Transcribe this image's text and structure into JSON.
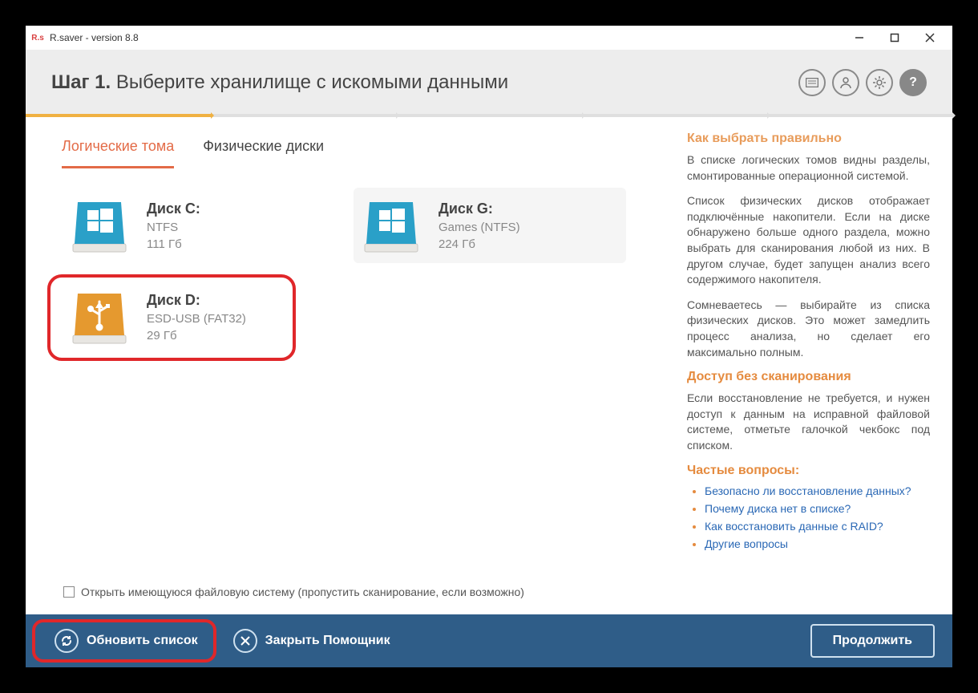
{
  "window": {
    "title": "R.saver - version 8.8"
  },
  "header": {
    "step_prefix": "Шаг 1.",
    "step_title": "Выберите хранилище с искомыми данными"
  },
  "tabs": {
    "logical": "Логические тома",
    "physical": "Физические диски"
  },
  "disks": {
    "c": {
      "name": "Диск C:",
      "fs": "NTFS",
      "size": "111 Гб"
    },
    "g": {
      "name": "Диск G:",
      "fs": "Games (NTFS)",
      "size": "224 Гб"
    },
    "d": {
      "name": "Диск D:",
      "fs": "ESD-USB (FAT32)",
      "size": "29 Гб"
    }
  },
  "checkbox": {
    "label": "Открыть имеющуюся файловую систему (пропустить сканирование, если возможно)"
  },
  "sidebar": {
    "h1_cut": "Как выбрать правильно",
    "p1": "В списке логических томов видны разделы, смонтированные операционной системой.",
    "p2": "Список физических дисков отображает подключённые накопители. Если на диске обнаружено больше одного раздела, можно выбрать для сканирования любой из них. В другом случае, будет запущен анализ всего содержимого накопителя.",
    "p3": "Сомневаетесь — выбирайте из списка физических дисков. Это может замедлить процесс анализа, но сделает его максимально полным.",
    "h2": "Доступ без сканирования",
    "p4": "Если восстановление не требуется, и нужен доступ к данным на исправной файловой системе, отметьте галочкой чекбокс под списком.",
    "h3": "Частые вопросы:",
    "faq": {
      "q1": "Безопасно ли восстановление данных?",
      "q2": "Почему диска нет в списке?",
      "q3": "Как восстановить данные с RAID?",
      "q4": "Другие вопросы"
    }
  },
  "footer": {
    "refresh": "Обновить список",
    "close": "Закрыть Помощник",
    "next": "Продолжить"
  }
}
